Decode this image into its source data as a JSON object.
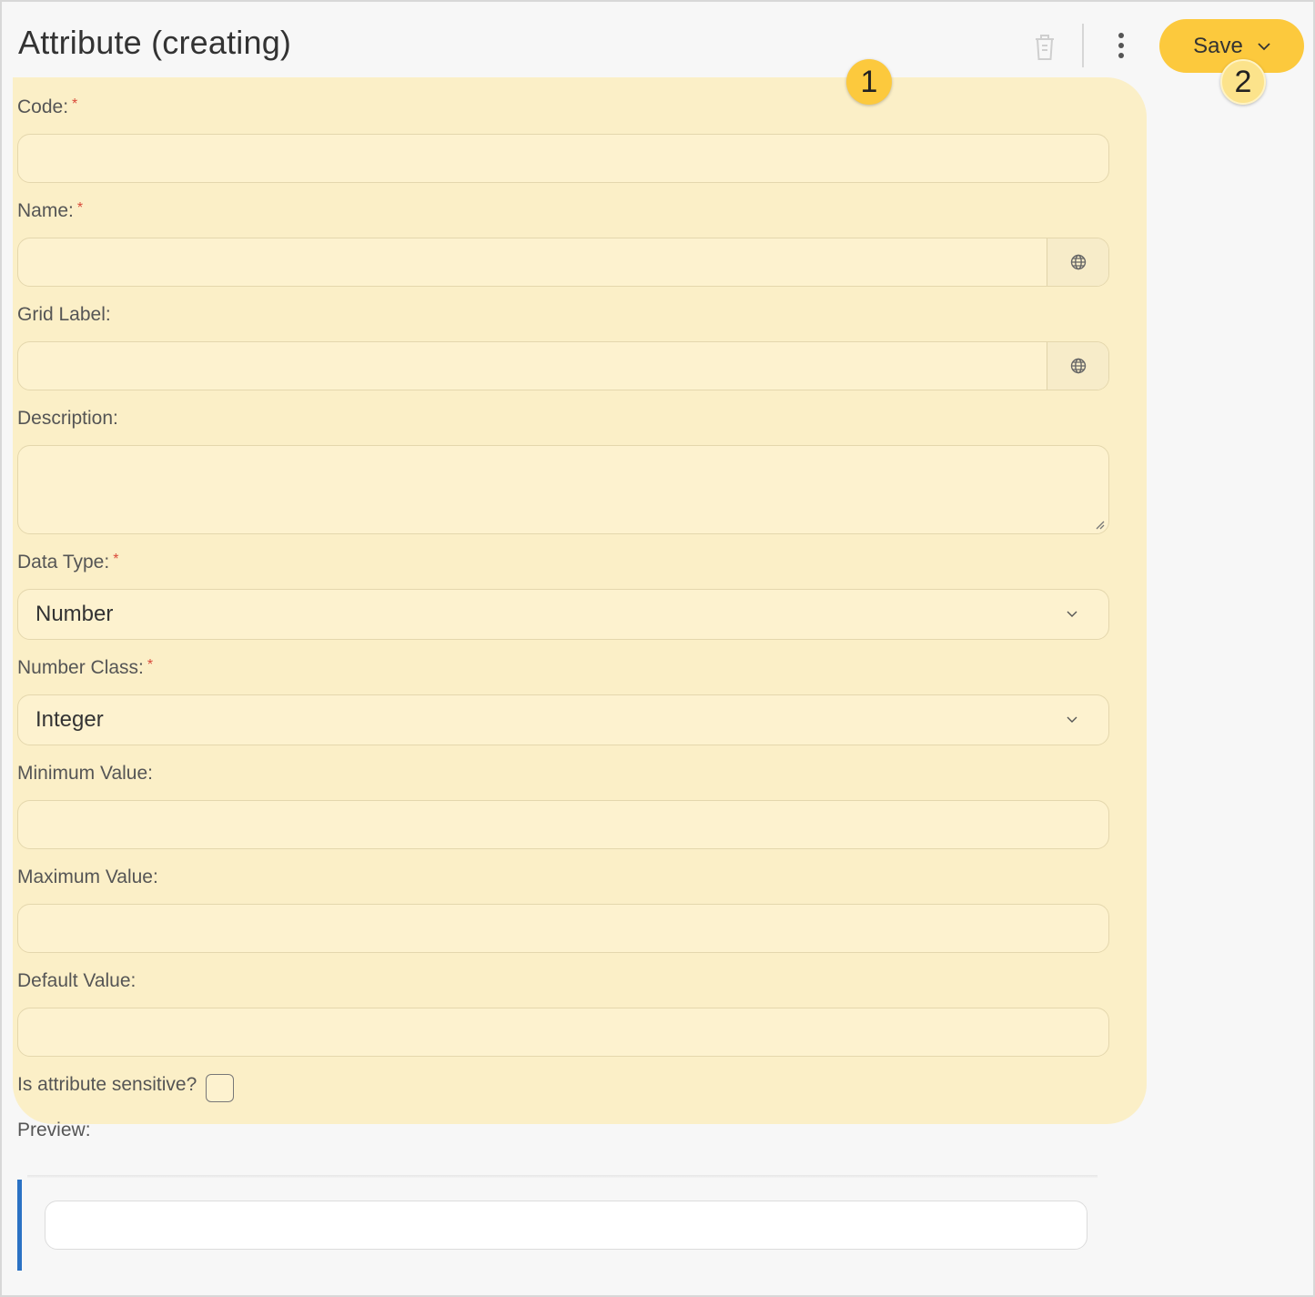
{
  "header": {
    "title": "Attribute (creating)",
    "save_label": "Save"
  },
  "annotations": {
    "badge_1": "1",
    "badge_2": "2"
  },
  "form": {
    "code_label": "Code:",
    "name_label": "Name:",
    "grid_label_label": "Grid Label:",
    "description_label": "Description:",
    "data_type_label": "Data Type:",
    "data_type_value": "Number",
    "number_class_label": "Number Class:",
    "number_class_value": "Integer",
    "minimum_value_label": "Minimum Value:",
    "maximum_value_label": "Maximum Value:",
    "default_value_label": "Default Value:",
    "sensitive_label": "Is attribute sensitive?",
    "required_marker": "*"
  },
  "preview": {
    "label": "Preview:"
  },
  "icons": {
    "trash": "trash-icon",
    "more": "kebab-menu-icon",
    "dropdown": "chevron-down-icon",
    "translate": "globe-icon"
  },
  "colors": {
    "accent": "#fcc93d",
    "highlight": "#fbefc7",
    "preview_bar": "#2b72c4",
    "required": "#d94a3a"
  }
}
